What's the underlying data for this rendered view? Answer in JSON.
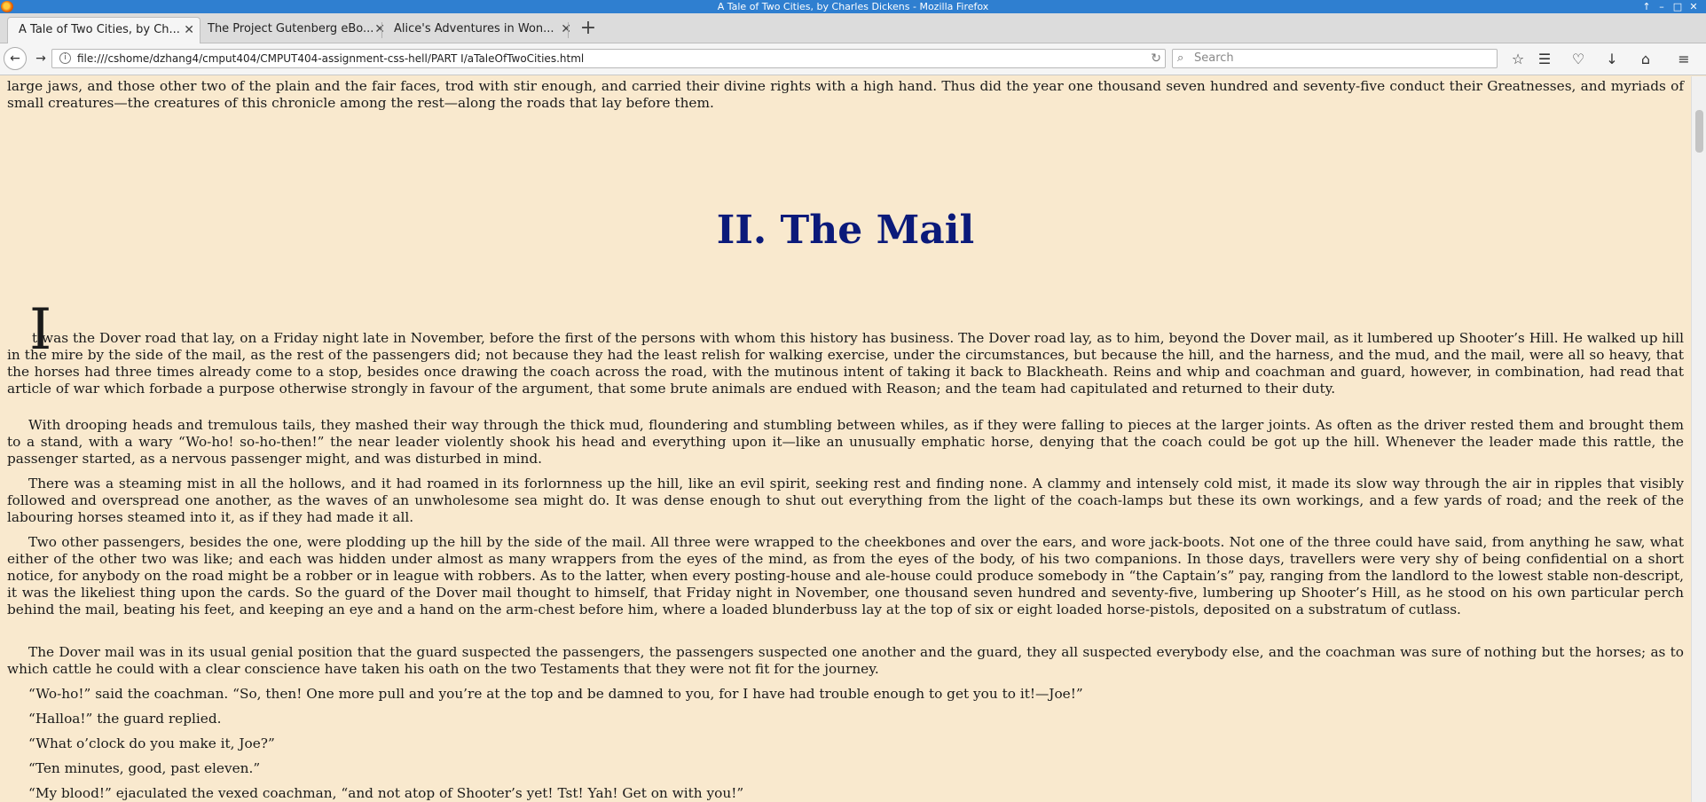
{
  "window": {
    "title": "A Tale of Two Cities, by Charles Dickens - Mozilla Firefox",
    "controls": [
      "↑",
      "–",
      "□",
      "✕"
    ]
  },
  "tabs": [
    {
      "label": "A Tale of Two Cities, by Ch...",
      "active": true
    },
    {
      "label": "The Project Gutenberg eBo...",
      "active": false
    },
    {
      "label": "Alice's Adventures in Won...",
      "active": false
    }
  ],
  "tab_close_glyph": "✕",
  "new_tab_glyph": "+",
  "nav": {
    "back_glyph": "←",
    "forward_glyph": "→",
    "url": "file:///cshome/dzhang4/cmput404/CMPUT404-assignment-css-hell/PART I/aTaleOfTwoCities.html",
    "search_placeholder": "Search",
    "icons": [
      "bookmark-star-icon",
      "reading-list-icon",
      "pocket-icon",
      "download-icon",
      "home-icon",
      "menu-icon"
    ]
  },
  "content": {
    "top_paragraph": "large jaws, and those other two of the plain and the fair faces, trod with stir enough, and carried their divine rights with a high hand. Thus did the year one thousand seven hundred and seventy-five conduct their Greatnesses, and myriads of small creatures—the creatures of this chronicle among the rest—along the roads that lay before them.",
    "chapter_title": "II. The Mail",
    "drop_cap": "I",
    "p1": "t was the Dover road that lay, on a Friday night late in November, before the first of the persons with whom this history has business. The Dover road lay, as to him, beyond the Dover mail, as it lumbered up Shooter’s Hill. He walked up hill in the mire by the side of the mail, as the rest of the passengers did; not because they had the least relish for walking exercise, under the circumstances, but because the hill, and the harness, and the mud, and the mail, were all so heavy, that the horses had three times already come to a stop, besides once drawing the coach across the road, with the mutinous intent of taking it back to Blackheath. Reins and whip and coachman and guard, however, in combination, had read that article of war which forbade a purpose otherwise strongly in favour of the argument, that some brute animals are endued with Reason; and the team had capitulated and returned to their duty.",
    "p2": "With drooping heads and tremulous tails, they mashed their way through the thick mud, floundering and stumbling between whiles, as if they were falling to pieces at the larger joints. As often as the driver rested them and brought them to a stand, with a wary “Wo-ho! so-ho-then!” the near leader violently shook his head and everything upon it—like an unusually emphatic horse, denying that the coach could be got up the hill. Whenever the leader made this rattle, the passenger started, as a nervous passenger might, and was disturbed in mind.",
    "p3": "There was a steaming mist in all the hollows, and it had roamed in its forlornness up the hill, like an evil spirit, seeking rest and finding none. A clammy and intensely cold mist, it made its slow way through the air in ripples that visibly followed and overspread one another, as the waves of an unwholesome sea might do. It was dense enough to shut out everything from the light of the coach-lamps but these its own workings, and a few yards of road; and the reek of the labouring horses steamed into it, as if they had made it all.",
    "p4": "Two other passengers, besides the one, were plodding up the hill by the side of the mail. All three were wrapped to the cheekbones and over the ears, and wore jack-boots. Not one of the three could have said, from anything he saw, what either of the other two was like; and each was hidden under almost as many wrappers from the eyes of the mind, as from the eyes of the body, of his two companions. In those days, travellers were very shy of being confidential on a short notice, for anybody on the road might be a robber or in league with robbers. As to the latter, when every posting-house and ale-house could produce somebody in “the Captain’s” pay, ranging from the landlord to the lowest stable non-descript, it was the likeliest thing upon the cards. So the guard of the Dover mail thought to himself, that Friday night in November, one thousand seven hundred and seventy-five, lumbering up Shooter’s Hill, as he stood on his own particular perch behind the mail, beating his feet, and keeping an eye and a hand on the arm-chest before him, where a loaded blunderbuss lay at the top of six or eight loaded horse-pistols, deposited on a substratum of cutlass.",
    "p5": "The Dover mail was in its usual genial position that the guard suspected the passengers, the passengers suspected one another and the guard, they all suspected everybody else, and the coachman was sure of nothing but the horses; as to which cattle he could with a clear conscience have taken his oath on the two Testaments that they were not fit for the journey.",
    "p6": "“Wo-ho!” said the coachman. “So, then! One more pull and you’re at the top and be damned to you, for I have had trouble enough to get you to it!—Joe!”",
    "p7": "“Halloa!” the guard replied.",
    "p8": "“What o’clock do you make it, Joe?”",
    "p9": "“Ten minutes, good, past eleven.”",
    "p10": "“My blood!” ejaculated the vexed coachman, “and not atop of Shooter’s yet! Tst! Yah! Get on with you!”"
  }
}
